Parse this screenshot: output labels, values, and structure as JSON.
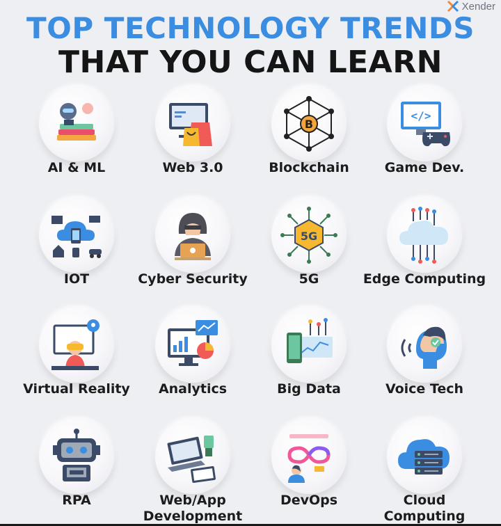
{
  "watermark": "Xender",
  "title_line1": "TOP TECHNOLOGY TRENDS",
  "title_line2": "THAT YOU CAN LEARN",
  "colors": {
    "title_blue": "#3a8de0",
    "title_dark": "#151515",
    "background": "#eeeff3"
  },
  "items": [
    {
      "label": "AI & ML",
      "icon": "robot-books-icon"
    },
    {
      "label": "Web 3.0",
      "icon": "shopping-monitor-icon"
    },
    {
      "label": "Blockchain",
      "icon": "bitcoin-network-icon"
    },
    {
      "label": "Game Dev.",
      "icon": "gamepad-monitor-icon"
    },
    {
      "label": "IOT",
      "icon": "cloud-devices-icon"
    },
    {
      "label": "Cyber Security",
      "icon": "hacker-laptop-icon"
    },
    {
      "label": "5G",
      "icon": "5g-chip-icon"
    },
    {
      "label": "Edge Computing",
      "icon": "cloud-circuit-icon"
    },
    {
      "label": "Virtual Reality",
      "icon": "vr-headset-icon"
    },
    {
      "label": "Analytics",
      "icon": "analytics-monitor-icon"
    },
    {
      "label": "Big Data",
      "icon": "phone-data-icon"
    },
    {
      "label": "Voice Tech",
      "icon": "voice-head-icon"
    },
    {
      "label": "RPA",
      "icon": "robot-head-icon"
    },
    {
      "label": "Web/App Development",
      "icon": "laptop-tablet-icon"
    },
    {
      "label": "DevOps",
      "icon": "infinity-loop-icon"
    },
    {
      "label": "Cloud Computing",
      "icon": "cloud-server-icon"
    }
  ]
}
